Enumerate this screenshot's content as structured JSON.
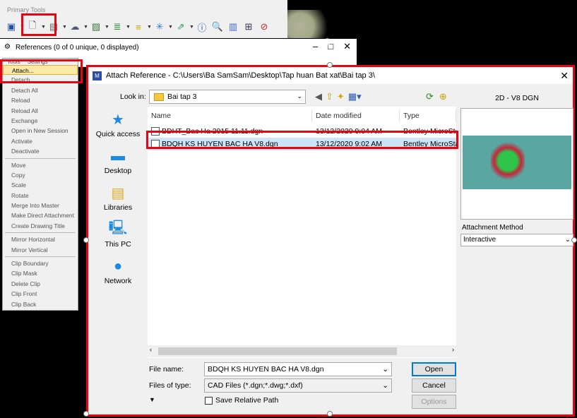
{
  "primary_tools": {
    "title": "Primary Tools",
    "icons": [
      "window-icon",
      "attach-reference-icon",
      "sheet-icon",
      "raster-icon",
      "image-icon",
      "model-icon",
      "layers-icon",
      "light-icon",
      "nav-icon",
      "info-icon",
      "search-icon",
      "chart-icon",
      "grid-icon",
      "disable-icon"
    ]
  },
  "references": {
    "title": "References (0 of 0 unique, 0 displayed)",
    "menubar": [
      "Tools",
      "Settings"
    ]
  },
  "context_menu": {
    "items": [
      {
        "label": "Attach...",
        "active": true
      },
      {
        "label": "Detach"
      },
      {
        "label": "Detach All"
      },
      {
        "label": "Reload"
      },
      {
        "label": "Reload All"
      },
      {
        "label": "Exchange"
      },
      {
        "label": "Open in New Session"
      },
      {
        "label": "Activate"
      },
      {
        "label": "Deactivate"
      },
      {
        "sep": true
      },
      {
        "label": "Move"
      },
      {
        "label": "Copy"
      },
      {
        "label": "Scale"
      },
      {
        "label": "Rotate"
      },
      {
        "label": "Merge Into Master"
      },
      {
        "label": "Make Direct Attachment"
      },
      {
        "label": "Create Drawing Title"
      },
      {
        "sep": true
      },
      {
        "label": "Mirror Horizontal"
      },
      {
        "label": "Mirror Vertical"
      },
      {
        "sep": true
      },
      {
        "label": "Clip Boundary"
      },
      {
        "label": "Clip Mask"
      },
      {
        "label": "Delete Clip"
      },
      {
        "label": "Clip Front"
      },
      {
        "label": "Clip Back"
      }
    ]
  },
  "dialog": {
    "title": "Attach Reference - C:\\Users\\Ba SamSam\\Desktop\\Tap huan Bat xat\\Bai tap 3\\",
    "look_in_label": "Look in:",
    "look_in_value": "Bai tap 3",
    "places": [
      {
        "label": "Quick access",
        "icon": "star-icon"
      },
      {
        "label": "Desktop",
        "icon": "desktop-icon"
      },
      {
        "label": "Libraries",
        "icon": "libraries-icon"
      },
      {
        "label": "This PC",
        "icon": "pc-icon"
      },
      {
        "label": "Network",
        "icon": "network-icon"
      }
    ],
    "columns": [
      "Name",
      "Date modified",
      "Type"
    ],
    "files": [
      {
        "name": "BDHT_Bac Ha 2015 11.11.dgn",
        "date": "13/12/2020 9:04 AM",
        "type": "Bentley MicroSta",
        "selected": false
      },
      {
        "name": "BDQH KS HUYEN BAC HA V8.dgn",
        "date": "13/12/2020 9:02 AM",
        "type": "Bentley MicroSta",
        "selected": true
      }
    ],
    "preview_label": "2D - V8 DGN",
    "attachment_method_label": "Attachment Method",
    "attachment_method_value": "Interactive",
    "file_name_label": "File name:",
    "file_name_value": "BDQH KS HUYEN BAC HA V8.dgn",
    "files_of_type_label": "Files of type:",
    "files_of_type_value": "CAD Files (*.dgn;*.dwg;*.dxf)",
    "save_relative_label": "Save Relative Path",
    "buttons": {
      "open": "Open",
      "cancel": "Cancel",
      "options": "Options"
    }
  },
  "colors": {
    "highlight": "#e30613",
    "selection": "#cce4f7",
    "preview_bg": "#5aa6a0"
  }
}
